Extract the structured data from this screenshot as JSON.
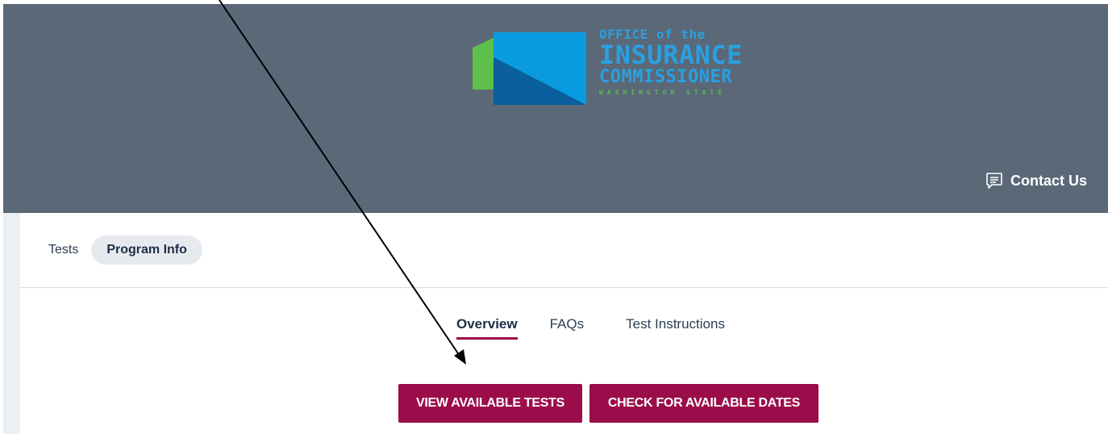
{
  "header": {
    "logo": {
      "line1": "OFFICE of the",
      "line2": "INSURANCE",
      "line3": "COMMISSIONER",
      "line4": "WASHINGTON STATE",
      "colors": {
        "blue": "#0a9ae0",
        "dark_blue": "#0a5f9c",
        "green": "#5ec04a"
      }
    },
    "contact_label": "Contact Us",
    "contact_icon": "chat-message-icon",
    "background": "#5a6878"
  },
  "top_tabs": [
    "Tests",
    "Program Info"
  ],
  "top_tabs_active": "Program Info",
  "sub_nav": [
    "Overview",
    "FAQs",
    "Test Instructions"
  ],
  "sub_nav_active": "Overview",
  "buttons": {
    "view_tests": "VIEW AVAILABLE TESTS",
    "check_dates": "CHECK FOR AVAILABLE DATES"
  },
  "accent_color": "#9b0d4a",
  "annotation": "arrow pointing to VIEW AVAILABLE TESTS button"
}
